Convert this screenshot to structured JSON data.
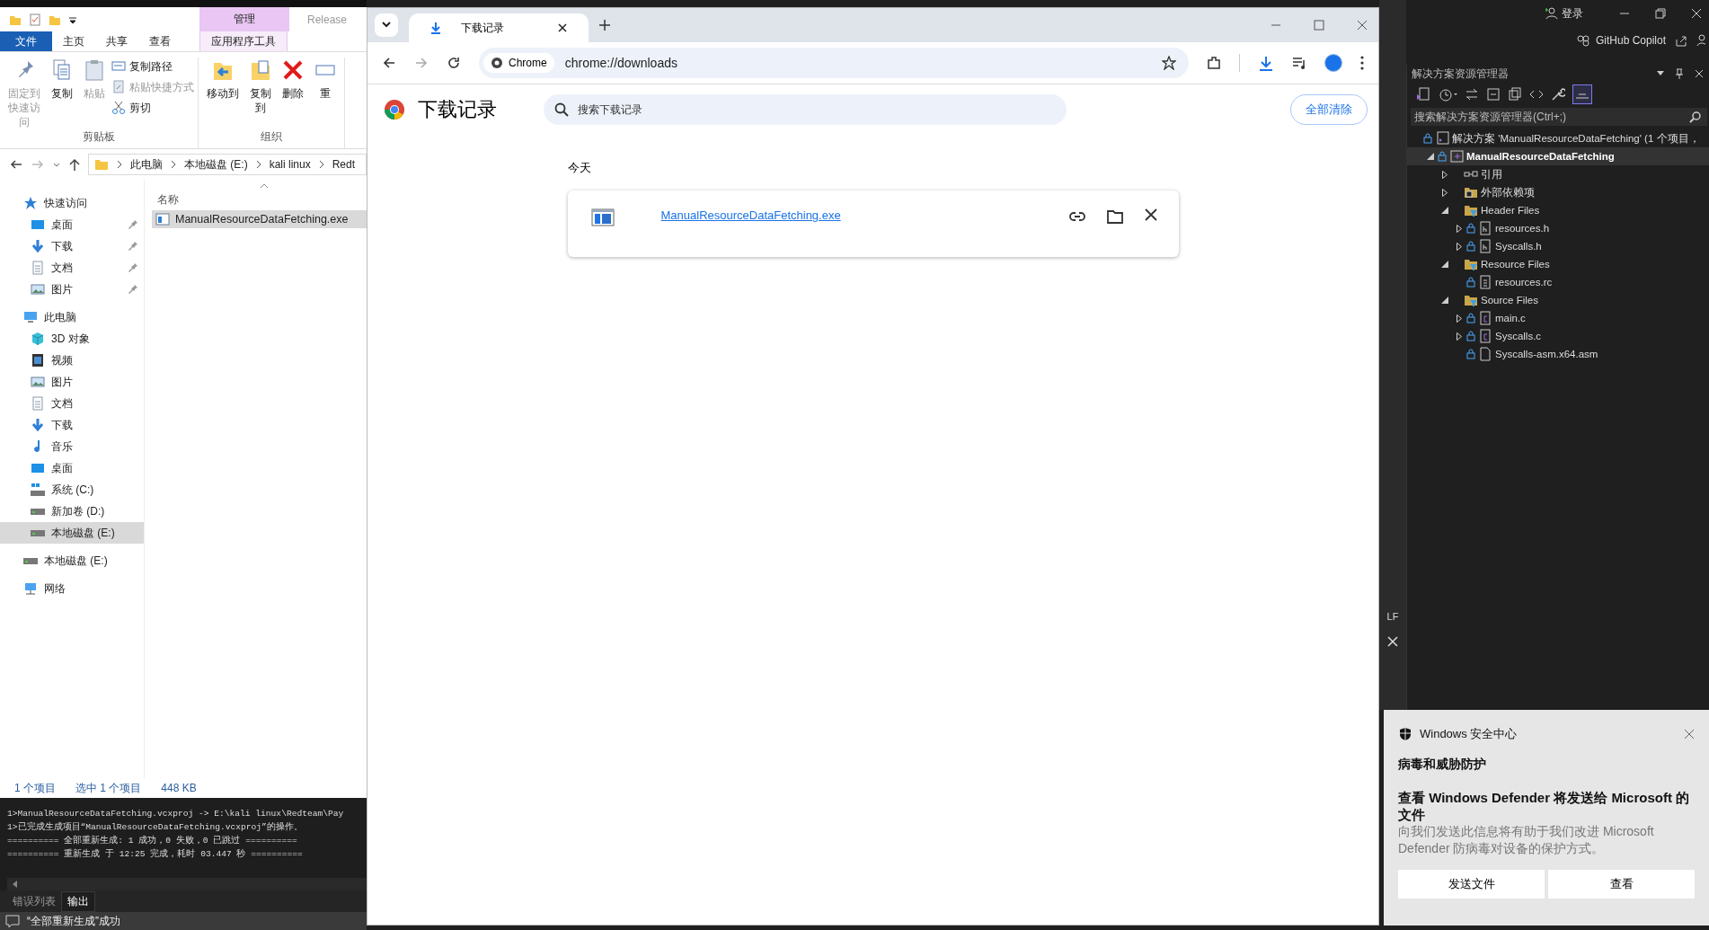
{
  "explorer": {
    "context_tab": "管理",
    "title": "Release",
    "ribbon_tabs": [
      {
        "label": "文件",
        "kind": "file"
      },
      {
        "label": "主页",
        "kind": "tab"
      },
      {
        "label": "共享",
        "kind": "tab"
      },
      {
        "label": "查看",
        "kind": "tab"
      },
      {
        "label": "应用程序工具",
        "kind": "context"
      }
    ],
    "ribbon_groups": [
      {
        "label": "剪贴板",
        "large": [
          {
            "label": "固定到快速访问",
            "kind": "pin",
            "disabled": true
          },
          {
            "label": "复制",
            "kind": "copy",
            "disabled": false
          },
          {
            "label": "粘贴",
            "kind": "paste",
            "disabled": true
          }
        ],
        "small": [
          {
            "label": "复制路径",
            "kind": "path",
            "disabled": false
          },
          {
            "label": "粘贴快捷方式",
            "kind": "shortcut",
            "disabled": true
          },
          {
            "label": "剪切",
            "kind": "cut",
            "disabled": false
          }
        ]
      },
      {
        "label": "组织",
        "large": [
          {
            "label": "移动到",
            "kind": "move",
            "disabled": false
          },
          {
            "label": "复制到",
            "kind": "copyto",
            "disabled": false
          },
          {
            "label": "删除",
            "kind": "delete",
            "disabled": false
          },
          {
            "label": "重",
            "kind": "rename",
            "disabled": false
          }
        ]
      }
    ],
    "breadcrumbs": [
      "此电脑",
      "本地磁盘 (E:)",
      "kali linux",
      "Redt"
    ],
    "nav": [
      {
        "label": "快速访问",
        "kind": "star",
        "selected": false,
        "pinned": false,
        "children": [
          {
            "label": "桌面",
            "kind": "desktop",
            "selected": false,
            "pinned": true
          },
          {
            "label": "下载",
            "kind": "download",
            "selected": false,
            "pinned": true
          },
          {
            "label": "文档",
            "kind": "doc",
            "selected": false,
            "pinned": true
          },
          {
            "label": "图片",
            "kind": "picture",
            "selected": false,
            "pinned": true
          }
        ]
      },
      {
        "label": "此电脑",
        "kind": "pc",
        "selected": false,
        "pinned": false,
        "children": [
          {
            "label": "3D 对象",
            "kind": "cube",
            "selected": false,
            "pinned": false
          },
          {
            "label": "视频",
            "kind": "video",
            "selected": false,
            "pinned": false
          },
          {
            "label": "图片",
            "kind": "picture",
            "selected": false,
            "pinned": false
          },
          {
            "label": "文档",
            "kind": "doc",
            "selected": false,
            "pinned": false
          },
          {
            "label": "下载",
            "kind": "download",
            "selected": false,
            "pinned": false
          },
          {
            "label": "音乐",
            "kind": "music",
            "selected": false,
            "pinned": false
          },
          {
            "label": "桌面",
            "kind": "desktop",
            "selected": false,
            "pinned": false
          },
          {
            "label": "系统 (C:)",
            "kind": "sysdrive",
            "selected": false,
            "pinned": false
          },
          {
            "label": "新加卷 (D:)",
            "kind": "drive",
            "selected": false,
            "pinned": false
          },
          {
            "label": "本地磁盘 (E:)",
            "kind": "drive",
            "selected": true,
            "pinned": false
          }
        ]
      },
      {
        "label": "本地磁盘 (E:)",
        "kind": "drive",
        "selected": false,
        "pinned": false
      },
      {
        "label": "网络",
        "kind": "network",
        "selected": false,
        "pinned": false
      }
    ],
    "column": "名称",
    "files": [
      {
        "name": "ManualResourceDataFetching.exe",
        "selected": true
      }
    ],
    "status": [
      "1 个项目",
      "选中 1 个项目",
      "448 KB"
    ]
  },
  "output": {
    "lines": [
      "1>ManualResourceDataFetching.vcxproj -> E:\\kali linux\\Redteam\\Pay",
      "1>已完成生成项目“ManualResourceDataFetching.vcxproj”的操作。",
      "========== 全部重新生成: 1 成功，0 失败，0 已跳过 ==========",
      "========== 重新生成 于 12:25 完成，耗时 03.447 秒 =========="
    ],
    "tabs": [
      {
        "label": "错误列表",
        "selected": false
      },
      {
        "label": "输出",
        "selected": true
      }
    ],
    "status": "“全部重新生成”成功"
  },
  "chrome": {
    "tabs": [
      {
        "title": "下载记录",
        "selected": true
      }
    ],
    "chip": "Chrome",
    "url": "chrome://downloads",
    "page_title": "下载记录",
    "search": {
      "placeholder": "搜索下载记录"
    },
    "clear_button": "全部清除",
    "section": "今天",
    "downloads": [
      {
        "file": "ManualResourceDataFetching.exe"
      }
    ]
  },
  "editor_strip": {
    "text": "LF"
  },
  "vs": {
    "sign_in": "登录",
    "copilot": "GitHub Copilot",
    "panel_title": "解决方案资源管理器",
    "search": {
      "placeholder": "搜索解决方案资源管理器(Ctrl+;)"
    },
    "tree": [
      {
        "label": "解决方案 'ManualResourceDataFetching' (1 个项目，",
        "kind": "solution",
        "locked": true,
        "selected": false,
        "children": [
          {
            "label": "ManualResourceDataFetching",
            "kind": "project",
            "expanded": true,
            "locked": true,
            "selected": true,
            "children": [
              {
                "label": "引用",
                "kind": "references",
                "expanded": false,
                "locked": false,
                "selected": false
              },
              {
                "label": "外部依赖项",
                "kind": "external",
                "expanded": false,
                "locked": false,
                "selected": false
              },
              {
                "label": "Header Files",
                "kind": "filter",
                "expanded": true,
                "locked": false,
                "selected": false,
                "children": [
                  {
                    "label": "resources.h",
                    "kind": "header",
                    "expanded": false,
                    "locked": true,
                    "selected": false
                  },
                  {
                    "label": "Syscalls.h",
                    "kind": "header",
                    "expanded": false,
                    "locked": true,
                    "selected": false
                  }
                ]
              },
              {
                "label": "Resource Files",
                "kind": "filter",
                "expanded": true,
                "locked": false,
                "selected": false,
                "children": [
                  {
                    "label": "resources.rc",
                    "kind": "resource",
                    "locked": true,
                    "selected": false
                  }
                ]
              },
              {
                "label": "Source Files",
                "kind": "filter",
                "expanded": true,
                "locked": false,
                "selected": false,
                "children": [
                  {
                    "label": "main.c",
                    "kind": "cfile",
                    "expanded": false,
                    "locked": true,
                    "selected": false
                  },
                  {
                    "label": "Syscalls.c",
                    "kind": "cfile",
                    "expanded": false,
                    "locked": true,
                    "selected": false
                  },
                  {
                    "label": "Syscalls-asm.x64.asm",
                    "kind": "file",
                    "locked": true,
                    "selected": false
                  }
                ]
              }
            ]
          }
        ]
      }
    ]
  },
  "toast": {
    "app": "Windows 安全中心",
    "heading": "病毒和威胁防护",
    "title": "查看 Windows Defender 将发送给 Microsoft 的文件",
    "body": "向我们发送此信息将有助于我们改进 Microsoft Defender 防病毒对设备的保护方式。",
    "buttons": [
      "发送文件",
      "查看"
    ]
  }
}
